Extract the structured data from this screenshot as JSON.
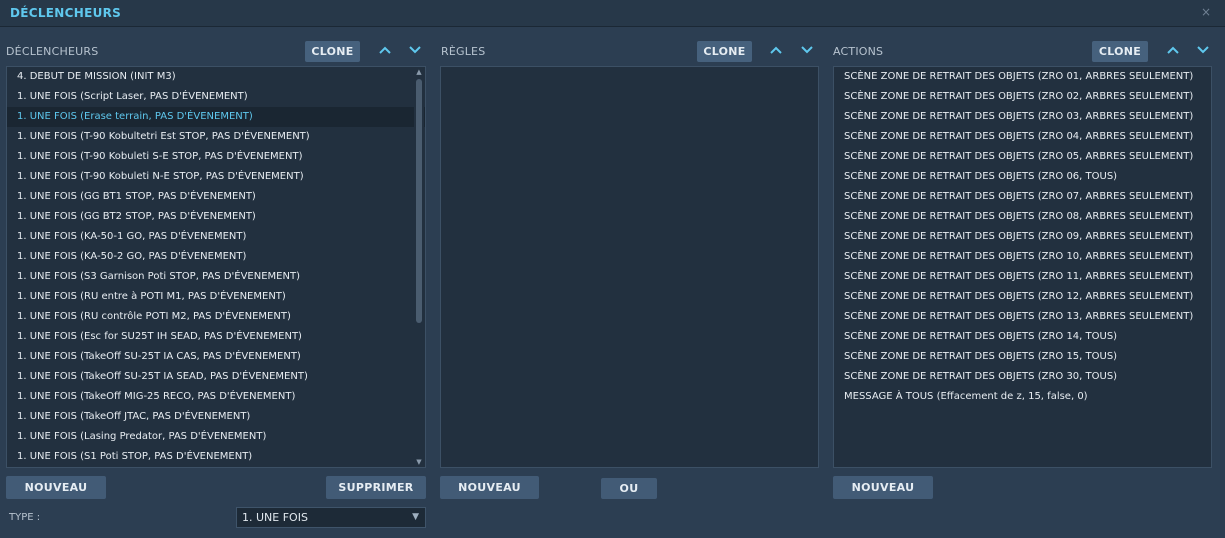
{
  "window": {
    "title": "DÉCLENCHEURS",
    "close_glyph": "×"
  },
  "triggers": {
    "header": "DÉCLENCHEURS",
    "clone_label": "CLONE",
    "new_label": "NOUVEAU",
    "delete_label": "SUPPRIMER",
    "items": [
      "4. DEBUT DE MISSION (INIT M3)",
      "1. UNE FOIS (Script Laser, PAS D'ÉVENEMENT)",
      "1. UNE FOIS (Erase terrain, PAS D'ÉVENEMENT)",
      "1. UNE FOIS (T-90 Kobultetri Est STOP, PAS D'ÉVENEMENT)",
      "1. UNE FOIS (T-90 Kobuleti S-E STOP, PAS D'ÉVENEMENT)",
      "1. UNE FOIS (T-90 Kobuleti N-E STOP, PAS D'ÉVENEMENT)",
      "1. UNE FOIS (GG BT1 STOP, PAS D'ÉVENEMENT)",
      "1. UNE FOIS (GG BT2 STOP, PAS D'ÉVENEMENT)",
      "1. UNE FOIS (KA-50-1 GO, PAS D'ÉVENEMENT)",
      "1. UNE FOIS (KA-50-2 GO, PAS D'ÉVENEMENT)",
      "1. UNE FOIS (S3 Garnison Poti STOP, PAS D'ÉVENEMENT)",
      "1. UNE FOIS (RU entre à POTI M1, PAS D'ÉVENEMENT)",
      "1. UNE FOIS (RU contrôle POTI M2, PAS D'ÉVENEMENT)",
      "1. UNE FOIS (Esc for SU25T IH SEAD, PAS D'ÉVENEMENT)",
      "1. UNE FOIS (TakeOff SU-25T IA CAS, PAS D'ÉVENEMENT)",
      "1. UNE FOIS (TakeOff SU-25T IA SEAD, PAS D'ÉVENEMENT)",
      "1. UNE FOIS (TakeOff MIG-25 RECO, PAS D'ÉVENEMENT)",
      "1. UNE FOIS (TakeOff JTAC, PAS D'ÉVENEMENT)",
      "1. UNE FOIS (Lasing Predator, PAS D'ÉVENEMENT)",
      "1. UNE FOIS (S1 Poti STOP, PAS D'ÉVENEMENT)"
    ],
    "selected_index": 2,
    "type_label": "TYPE :",
    "type_value": "1. UNE FOIS"
  },
  "rules": {
    "header": "RÈGLES",
    "clone_label": "CLONE",
    "new_label": "NOUVEAU",
    "or_label": "OU",
    "items": []
  },
  "actions": {
    "header": "ACTIONS",
    "clone_label": "CLONE",
    "new_label": "NOUVEAU",
    "items": [
      "SCÈNE ZONE DE RETRAIT DES OBJETS (ZRO 01, ARBRES SEULEMENT)",
      "SCÈNE ZONE DE RETRAIT DES OBJETS (ZRO 02, ARBRES SEULEMENT)",
      "SCÈNE ZONE DE RETRAIT DES OBJETS (ZRO 03, ARBRES SEULEMENT)",
      "SCÈNE ZONE DE RETRAIT DES OBJETS (ZRO 04, ARBRES SEULEMENT)",
      "SCÈNE ZONE DE RETRAIT DES OBJETS (ZRO 05, ARBRES SEULEMENT)",
      "SCÈNE ZONE DE RETRAIT DES OBJETS (ZRO 06, TOUS)",
      "SCÈNE ZONE DE RETRAIT DES OBJETS (ZRO 07, ARBRES SEULEMENT)",
      "SCÈNE ZONE DE RETRAIT DES OBJETS (ZRO 08, ARBRES SEULEMENT)",
      "SCÈNE ZONE DE RETRAIT DES OBJETS (ZRO 09, ARBRES SEULEMENT)",
      "SCÈNE ZONE DE RETRAIT DES OBJETS (ZRO 10, ARBRES SEULEMENT)",
      "SCÈNE ZONE DE RETRAIT DES OBJETS (ZRO 11, ARBRES SEULEMENT)",
      "SCÈNE ZONE DE RETRAIT DES OBJETS (ZRO 12, ARBRES SEULEMENT)",
      "SCÈNE ZONE DE RETRAIT DES OBJETS (ZRO 13, ARBRES SEULEMENT)",
      "SCÈNE ZONE DE RETRAIT DES OBJETS (ZRO 14, TOUS)",
      "SCÈNE ZONE DE RETRAIT DES OBJETS (ZRO 15, TOUS)",
      "SCÈNE ZONE DE RETRAIT DES OBJETS (ZRO 30, TOUS)",
      "MESSAGE À TOUS (Effacement de z, 15, false, 0)"
    ]
  },
  "colors": {
    "accent": "#5fc8ee",
    "background": "#2c3e52",
    "panel": "#22303f",
    "button": "#46617d"
  }
}
